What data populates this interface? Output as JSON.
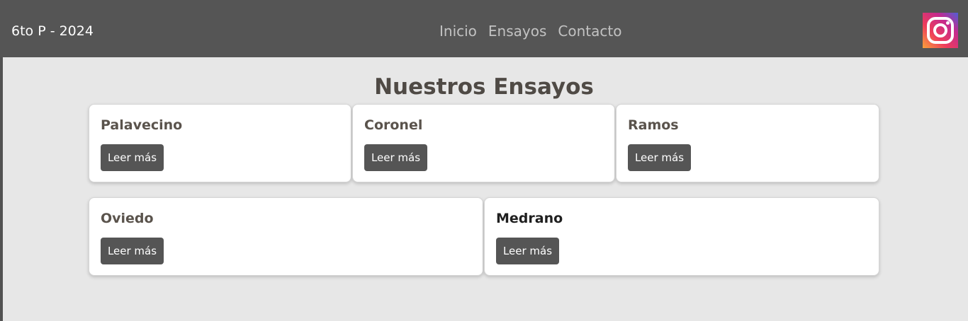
{
  "navbar": {
    "brand": "6to P - 2024",
    "links": [
      {
        "label": "Inicio"
      },
      {
        "label": "Ensayos"
      },
      {
        "label": "Contacto"
      }
    ],
    "social_icon": "instagram-icon"
  },
  "main": {
    "title": "Nuestros Ensayos",
    "cards": [
      {
        "title": "Palavecino",
        "button": "Leer más"
      },
      {
        "title": "Coronel",
        "button": "Leer más"
      },
      {
        "title": "Ramos",
        "button": "Leer más"
      },
      {
        "title": "Oviedo",
        "button": "Leer más"
      },
      {
        "title": "Medrano",
        "button": "Leer más"
      }
    ]
  },
  "colors": {
    "navbar": "#555555",
    "content_bg": "#e7e7e7",
    "button_bg": "#555555",
    "title_text": "#4f4a45"
  }
}
